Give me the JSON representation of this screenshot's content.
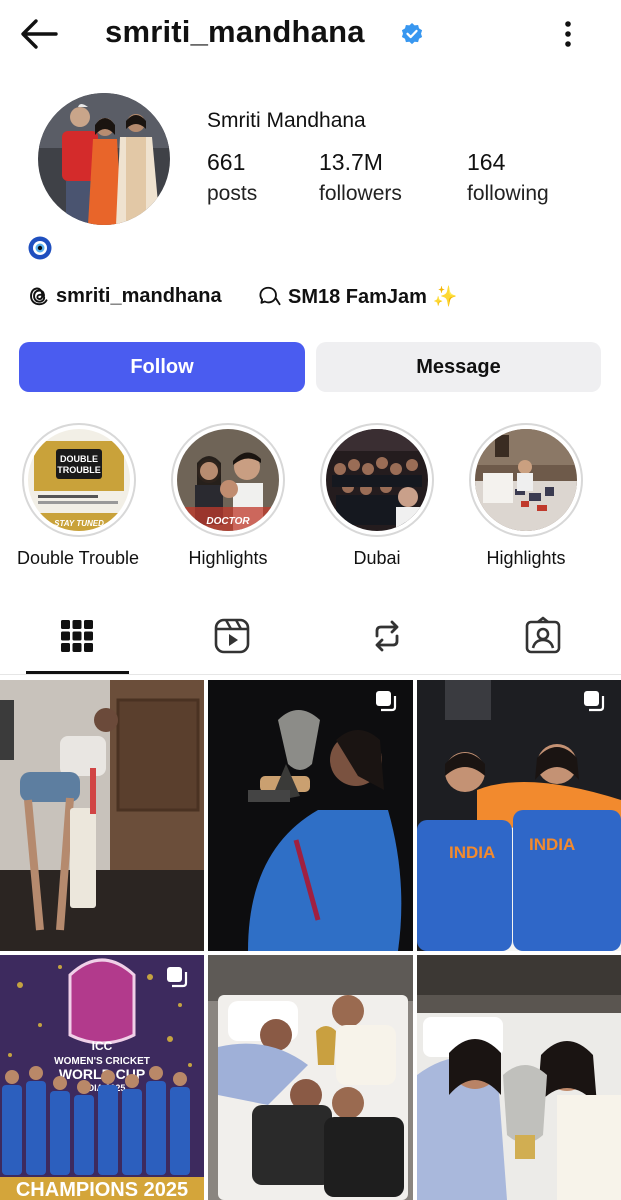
{
  "header": {
    "username": "smriti_mandhana",
    "back_icon": "arrow-left-icon",
    "verified_icon": "verified-badge-icon",
    "more_icon": "more-vertical-icon"
  },
  "profile": {
    "display_name": "Smriti Mandhana",
    "stats": [
      {
        "value": "661",
        "label": "posts"
      },
      {
        "value": "13.7M",
        "label": "followers"
      },
      {
        "value": "164",
        "label": "following"
      }
    ],
    "bio_icon": "evil-eye-icon",
    "threads_handle": "smriti_mandhana",
    "channel_name": "SM18 FamJam ✨"
  },
  "actions": {
    "follow_label": "Follow",
    "message_label": "Message"
  },
  "highlights": [
    {
      "label": "Double Trouble"
    },
    {
      "label": "Highlights"
    },
    {
      "label": "Dubai"
    },
    {
      "label": "Highlights"
    }
  ],
  "highlight_texts": {
    "dt_line1": "DOUBLE",
    "dt_line2": "TROUBLE",
    "dt_footer": "STAY TUNED",
    "hl_footer": "DOCTOR"
  },
  "tabs": [
    "grid-icon",
    "reels-icon",
    "reposts-icon",
    "tagged-icon"
  ],
  "posts": {
    "p4_line1": "ICC",
    "p4_line2": "WOMEN'S CRICKET",
    "p4_line3": "WORLD CUP",
    "p4_line4": "INDIA 2025",
    "p4_banner": "CHAMPIONS 2025",
    "p3_jersey": "INDIA"
  },
  "colors": {
    "follow_bg": "#4a5cf0",
    "verified": "#3897f0"
  }
}
